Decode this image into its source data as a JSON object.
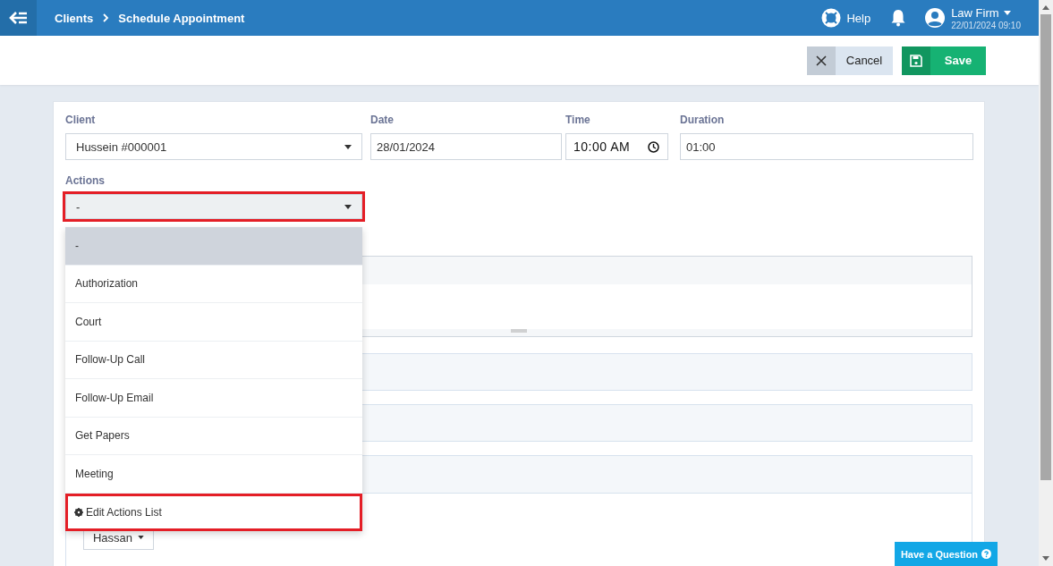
{
  "header": {
    "breadcrumb": [
      "Clients",
      "Schedule Appointment"
    ],
    "help": "Help",
    "account": {
      "name": "Law Firm",
      "datetime": "22/01/2024 09:10"
    }
  },
  "toolbar": {
    "buttons": [
      {
        "label": "Cancel",
        "kind": "cancel"
      },
      {
        "label": "Save",
        "kind": "save"
      }
    ]
  },
  "form": {
    "fields": [
      {
        "label": "Client",
        "value": "Hussein #000001",
        "kind": "select"
      },
      {
        "label": "Date",
        "value": "28/01/2024",
        "kind": "text"
      },
      {
        "label": "Time",
        "value": "10:00 AM",
        "kind": "time"
      },
      {
        "label": "Duration",
        "value": "01:00",
        "kind": "text"
      }
    ],
    "actions": {
      "label": "Actions",
      "value": "-",
      "highlighted": true,
      "options": [
        {
          "label": "-",
          "selected": true
        },
        {
          "label": "Authorization",
          "selected": false
        },
        {
          "label": "Court",
          "selected": false
        },
        {
          "label": "Follow-Up Call",
          "selected": false
        },
        {
          "label": "Follow-Up Email",
          "selected": false
        },
        {
          "label": "Get Papers",
          "selected": false
        },
        {
          "label": "Meeting",
          "selected": false
        }
      ],
      "edit_link": {
        "label": "Edit Actions List",
        "highlighted": true
      }
    },
    "assignee": "Hassan"
  },
  "help_button": "Have a Question"
}
